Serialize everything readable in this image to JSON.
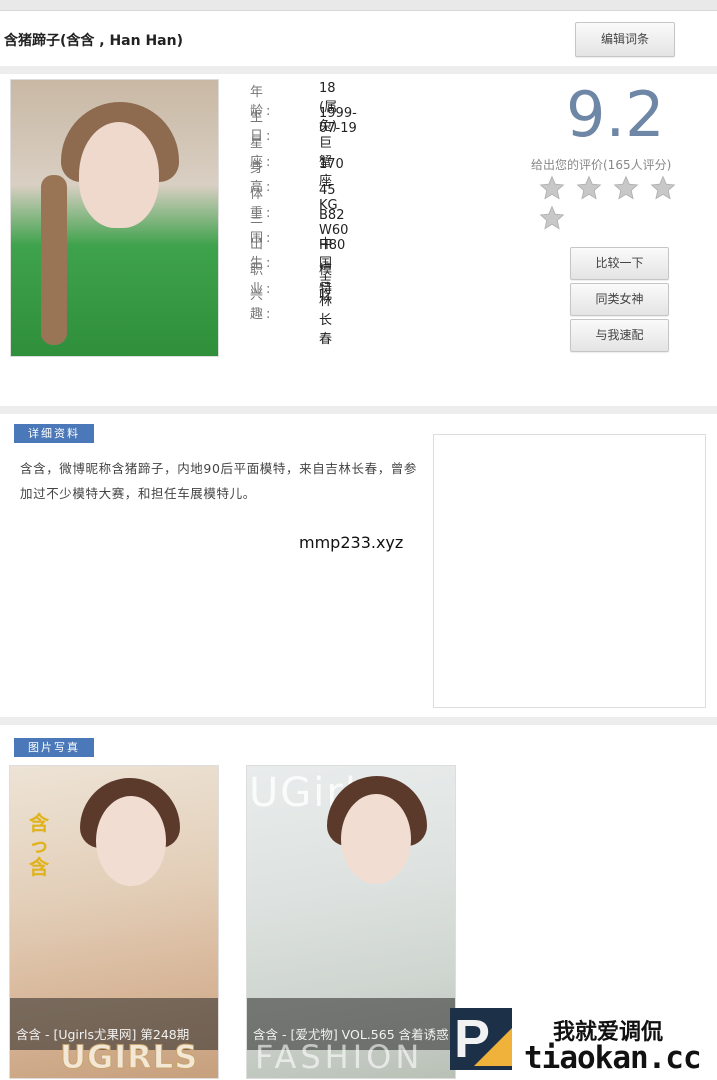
{
  "header": {
    "model_title": "含猪蹄子(含含 , Han Han)",
    "edit_button": "编辑词条"
  },
  "profile": {
    "fields": [
      {
        "label": "年 龄:",
        "value": "18 (属兔)"
      },
      {
        "label": "生 日:",
        "value": "1999-07-19"
      },
      {
        "label": "星 座:",
        "value": "巨蟹座"
      },
      {
        "label": "身 高:",
        "value": "170"
      },
      {
        "label": "体 重:",
        "value": "45 KG"
      },
      {
        "label": "三 围:",
        "value": "B82 W60 H80"
      },
      {
        "label": "出 生:",
        "value": "中国 吉林长春"
      },
      {
        "label": "职 业:",
        "value": "模特"
      },
      {
        "label": "兴 趣:",
        "value": "吃"
      }
    ]
  },
  "rating": {
    "score": "9.2",
    "note": "给出您的评价(165人评分)",
    "stars_total": 5,
    "star_color": "#c8c8c8"
  },
  "actions": {
    "compare": "比较一下",
    "similar": "同类女神",
    "match": "与我速配"
  },
  "details": {
    "tag": "详细资料",
    "bio": "含含，微博昵称含猪蹄子，内地90后平面模特，来自吉林长春，曾参加过不少模特大赛，和担任车展模特儿。",
    "watermark": "mmp233.xyz"
  },
  "gallery": {
    "tag": "图片写真",
    "albums": [
      {
        "caption": "含含 - [Ugirls尤果网] 第248期",
        "brand": "UGIRLS",
        "side_text": "含っ含"
      },
      {
        "caption": "含含 - [爱尤物] VOL.565 含着诱惑",
        "brand": "FASHION",
        "top_text": "UGirls"
      }
    ]
  },
  "footer": {
    "badge_letter": "P",
    "slogan": "我就爱调侃",
    "domain": "tiaokan.cc"
  },
  "colors": {
    "accent_blue": "#4a78b8",
    "score_color": "#6f87a6"
  }
}
